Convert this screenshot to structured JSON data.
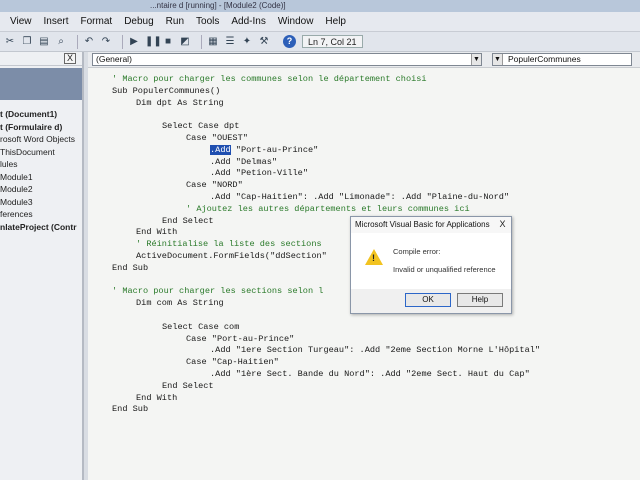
{
  "window": {
    "title": "...ntaire d [running] - [Module2 (Code)]"
  },
  "menu": [
    "View",
    "Insert",
    "Format",
    "Debug",
    "Run",
    "Tools",
    "Add-Ins",
    "Window",
    "Help"
  ],
  "toolbar": {
    "icons": [
      "cut-icon",
      "copy-icon",
      "paste-icon",
      "find-icon",
      "undo-icon",
      "redo-icon",
      "run-icon",
      "break-icon",
      "reset-icon",
      "design-mode-icon",
      "project-explorer-icon",
      "properties-icon",
      "object-browser-icon",
      "toolbox-icon"
    ],
    "help_label": "?",
    "cursor_position": "Ln 7, Col 21"
  },
  "project_pane": {
    "close_label": "X",
    "items": [
      {
        "label": "t (Document1)",
        "bold": true
      },
      {
        "label": "t (Formulaire d)",
        "bold": true
      },
      {
        "label": "rosoft Word Objects",
        "bold": false
      },
      {
        "label": "ThisDocument",
        "bold": false
      },
      {
        "label": "lules",
        "bold": false
      },
      {
        "label": "Module1",
        "bold": false
      },
      {
        "label": "Module2",
        "bold": false
      },
      {
        "label": "Module3",
        "bold": false
      },
      {
        "label": "ferences",
        "bold": false
      },
      {
        "label": "nlateProject (Contr",
        "bold": true
      }
    ]
  },
  "code_window": {
    "object_dropdown": "(General)",
    "procedure_dropdown": "PopulerCommunes",
    "lines": [
      {
        "text": "' Macro pour charger les communes selon le département choisi",
        "type": "comment",
        "indent": 0
      },
      {
        "text": "Sub PopulerCommunes()",
        "type": "code",
        "indent": 0
      },
      {
        "text": "Dim dpt As String",
        "type": "code",
        "indent": 1
      },
      {
        "text": "",
        "type": "code",
        "indent": 0
      },
      {
        "text": "Select Case dpt",
        "type": "code",
        "indent": 2
      },
      {
        "text": "Case \"OUEST\"",
        "type": "code",
        "indent": 3
      },
      {
        "text": ".Add \"Port-au-Prince\"",
        "type": "selected",
        "indent": 4
      },
      {
        "text": ".Add \"Delmas\"",
        "type": "code",
        "indent": 4
      },
      {
        "text": ".Add \"Petion-Ville\"",
        "type": "code",
        "indent": 4
      },
      {
        "text": "Case \"NORD\"",
        "type": "code",
        "indent": 3
      },
      {
        "text": ".Add \"Cap-Haitien\": .Add \"Limonade\": .Add \"Plaine-du-Nord\"",
        "type": "code",
        "indent": 4
      },
      {
        "text": "' Ajoutez les autres départements et leurs communes ici",
        "type": "comment",
        "indent": 3
      },
      {
        "text": "End Select",
        "type": "code",
        "indent": 2
      },
      {
        "text": "End With",
        "type": "code",
        "indent": 1
      },
      {
        "text": "' Réinitialise la liste des sections",
        "type": "comment",
        "indent": 1
      },
      {
        "text": "ActiveDocument.FormFields(\"ddSection\"",
        "type": "code",
        "indent": 1
      },
      {
        "text": "End Sub",
        "type": "code",
        "indent": 0
      },
      {
        "text": "",
        "type": "code",
        "indent": 0
      },
      {
        "text": "' Macro pour charger les sections selon l",
        "type": "comment",
        "indent": 0
      },
      {
        "text": "Dim com As String",
        "type": "code",
        "indent": 1
      },
      {
        "text": "",
        "type": "code",
        "indent": 0
      },
      {
        "text": "Select Case com",
        "type": "code",
        "indent": 2
      },
      {
        "text": "Case \"Port-au-Prince\"",
        "type": "code",
        "indent": 3
      },
      {
        "text": ".Add \"1ere Section Turgeau\": .Add \"2eme Section Morne L'Hôpital\"",
        "type": "code",
        "indent": 4
      },
      {
        "text": "Case \"Cap-Haitien\"",
        "type": "code",
        "indent": 3
      },
      {
        "text": ".Add \"1ère Sect. Bande du Nord\": .Add \"2eme Sect. Haut du Cap\"",
        "type": "code",
        "indent": 4
      },
      {
        "text": "End Select",
        "type": "code",
        "indent": 2
      },
      {
        "text": "End With",
        "type": "code",
        "indent": 1
      },
      {
        "text": "End Sub",
        "type": "code",
        "indent": 0
      }
    ]
  },
  "dialog": {
    "title": "Microsoft Visual Basic for Applications",
    "close_label": "X",
    "heading": "Compile error:",
    "message": "Invalid or unqualified reference",
    "ok_label": "OK",
    "help_label": "Help"
  },
  "colors": {
    "selection": "#1f4fb0",
    "comment": "#2a7a2a",
    "keyword": "#1f3f9a",
    "warning": "#f2c320"
  }
}
